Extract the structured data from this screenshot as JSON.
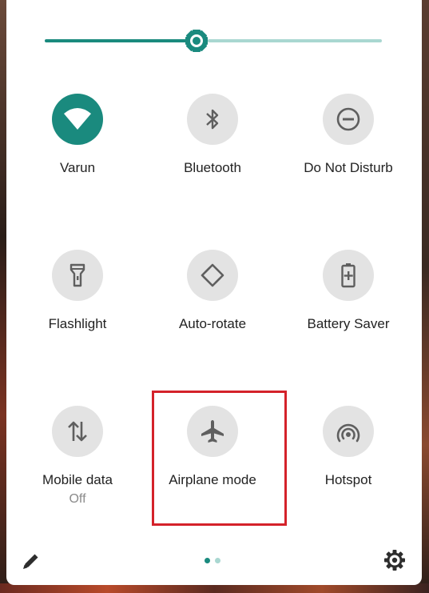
{
  "brightness": {
    "level": 0.45,
    "accent_color": "#1a8a7e",
    "track_color": "#a9d7d1"
  },
  "tiles": [
    {
      "label": "Varun",
      "icon": "wifi-icon",
      "active": true
    },
    {
      "label": "Bluetooth",
      "icon": "bluetooth-icon",
      "active": false
    },
    {
      "label": "Do Not Disturb",
      "icon": "do-not-disturb-icon",
      "active": false
    },
    {
      "label": "Flashlight",
      "icon": "flashlight-icon",
      "active": false
    },
    {
      "label": "Auto-rotate",
      "icon": "auto-rotate-icon",
      "active": false
    },
    {
      "label": "Battery Saver",
      "icon": "battery-saver-icon",
      "active": false
    },
    {
      "label": "Mobile data",
      "sublabel": "Off",
      "icon": "mobile-data-icon",
      "active": false
    },
    {
      "label": "Airplane mode",
      "icon": "airplane-icon",
      "active": false,
      "highlighted": true
    },
    {
      "label": "Hotspot",
      "icon": "hotspot-icon",
      "active": false
    }
  ],
  "footer": {
    "edit_icon": "pencil-icon",
    "settings_icon": "gear-icon",
    "page_count": 2,
    "current_page": 1
  },
  "colors": {
    "highlight": "#d4222a",
    "tile_bg": "#e3e3e3",
    "icon": "#5f5f5f"
  }
}
